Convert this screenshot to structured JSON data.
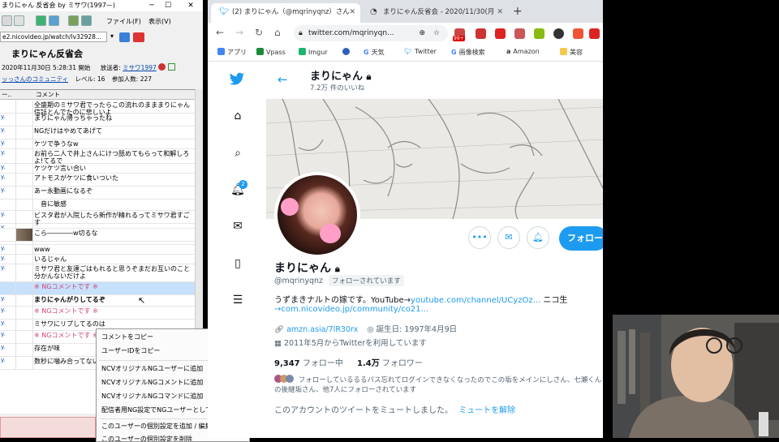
{
  "ncv": {
    "title": "まりにゃん 反省会 by ミサワ(1997—)",
    "menu_file": "ファイル(F)",
    "menu_view": "表示(V)",
    "url": "e2.nicovideo.jp/watch/lv32928...",
    "program_title": "まりにゃん反省会",
    "info_line1": "2020年11月30日 5:28:31 開始",
    "broadcaster_label": "放送者:",
    "broadcaster_name": "ミサワ1997",
    "community": "ッっさんのコミュニティ",
    "level": "レベル: 16",
    "participants": "参加人数: 227",
    "col_comment": "コメント",
    "rows": [
      {
        "id": "",
        "text": "全盛期のミサワ君でったらこの流れのまままりにゃん信話とんでたのに悲しいよ",
        "h": 16,
        "style": ""
      },
      {
        "id": "y.",
        "text": "まりにゃん帰っちゃったね",
        "h": 16,
        "style": ""
      },
      {
        "id": "y.",
        "text": "NGだけはやめてあげて",
        "h": 16,
        "style": ""
      },
      {
        "id": "y.",
        "text": "ケツで争うなw",
        "h": 12,
        "style": ""
      },
      {
        "id": "y.",
        "text": "お前ら二人で井上さんにけつ舐めてもらって和解しろよ!てるで",
        "h": 18,
        "style": ""
      },
      {
        "id": "y.",
        "text": "ケツケツ言い合い",
        "h": 12,
        "style": ""
      },
      {
        "id": "y.",
        "text": "アトモスがケツに食いついた",
        "h": 16,
        "style": ""
      },
      {
        "id": "y.",
        "text": "あー永動画になるぞ",
        "h": 16,
        "style": ""
      },
      {
        "id": "",
        "text": "　音に敏感",
        "h": 14,
        "style": ""
      },
      {
        "id": "y.",
        "text": "ビスタ君が入院したら新作が精れるってミサワ君すごす",
        "h": 16,
        "style": ""
      },
      {
        "id": "y.",
        "text": "",
        "h": 6,
        "style": ""
      },
      {
        "id": "",
        "text": "こら――――w切るな",
        "h": 16,
        "style": ""
      },
      {
        "id": "",
        "text": "",
        "h": 4,
        "style": ""
      },
      {
        "id": "y.",
        "text": "www",
        "h": 12,
        "style": ""
      },
      {
        "id": "y.",
        "text": "いるじゃん",
        "h": 12,
        "style": ""
      },
      {
        "id": "y.",
        "text": "ミサワ君と友達ごはもれると思うぞまだお互いのこと分かんないだけよ",
        "h": 22,
        "style": ""
      },
      {
        "id": "",
        "text": "※ NGコメントです ※",
        "h": 16,
        "style": "sel"
      },
      {
        "id": "y.",
        "text": "まりにゃんがりしてるぞ",
        "h": 14,
        "style": "bold"
      },
      {
        "id": "y.",
        "text": "※ NGコメントです ※",
        "h": 16,
        "style": "ng"
      },
      {
        "id": "y.",
        "text": "ミサワにリプしてるのは",
        "h": 14,
        "style": ""
      },
      {
        "id": "y.",
        "text": "※ NGコメントです ※",
        "h": 16,
        "style": "ng"
      },
      {
        "id": "y.",
        "text": "存在が味",
        "h": 16,
        "style": ""
      },
      {
        "id": "y.",
        "text": "数秒に噛み合ってない",
        "h": 16,
        "style": ""
      }
    ]
  },
  "context_menu": {
    "items": [
      "コメントをコピー",
      "ユーザーIDをコピー",
      "NCVオリジナルNGユーザーに追加",
      "NCVオリジナルNGコメントに追加",
      "NCVオリジナルNGコマンドに追加",
      "配信者用NG設定でNGユーザーとして登録",
      "このユーザーの個別設定を追加 / 編集する",
      "このユーザーの個別設定を削除"
    ]
  },
  "chrome": {
    "tab1": "(2) まりにゃん（@mqrinyqnz）さん",
    "tab2": "まりにゃん反省会 - 2020/11/30(月",
    "omnibox": "twitter.com/mqrinyqn...",
    "bookmarks": [
      {
        "label": "アプリ",
        "color": "#4285f4"
      },
      {
        "label": "Vpass",
        "color": "#1a8a3a"
      },
      {
        "label": "Imgur",
        "color": "#1bb76e"
      },
      {
        "label": "",
        "color": "#2c5fbd"
      },
      {
        "label": "天気",
        "color": "#4285f4"
      },
      {
        "label": "Twitter",
        "color": "#1d9bf0"
      },
      {
        "label": "画像検索",
        "color": "#4285f4"
      },
      {
        "label": "Amazon",
        "color": "#222222"
      },
      {
        "label": "美容",
        "color": "#f2c94c"
      }
    ],
    "ext_badge": "99+"
  },
  "twitter": {
    "header_name": "まりにゃん",
    "header_likes": "7.2万 件のいいね",
    "notif_count": "2",
    "follow_label": "フォロー",
    "name": "まりにゃん",
    "handle": "@mqrinyqnz",
    "follows_you": "フォローされています",
    "bio_text": "うずまきナルトの嫁です。YouTube→",
    "bio_link1": "youtube.com/channel/UCyzOz...",
    "bio_tail": " ニコ生",
    "bio_link2": "→com.nicovideo.jp/community/co21...",
    "site": "amzn.asia/7lR30rx",
    "birthday": "誕生日: 1997年4月9日",
    "joined": "2011年5月からTwitterを利用しています",
    "following_count": "9,347",
    "following_label": " フォロー中",
    "followers_count": "1.4万",
    "followers_label": " フォロワー",
    "known_followers": "フォローしているるるバス忘れてログインできなくなったのでこの垢をメインにしさん、七瀬くんの後継垢さん、他7人にフォローされています",
    "muted_text": "このアカウントのツイートをミュートしました。",
    "unmute": "ミュートを解除"
  }
}
